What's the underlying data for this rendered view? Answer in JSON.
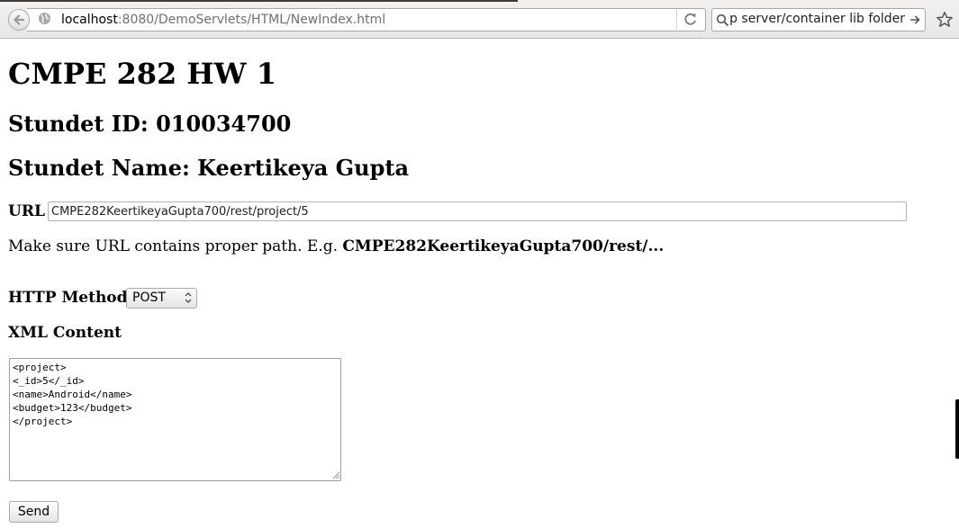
{
  "browser": {
    "url_host": "localhost",
    "url_rest": ":8080/DemoServlets/HTML/NewIndex.html",
    "search_text": "p server/container lib folder."
  },
  "page": {
    "title": "CMPE 282 HW 1",
    "student_id": "Stundet ID: 010034700",
    "student_name": "Stundet Name: Keertikeya Gupta",
    "url_label": "URL",
    "url_value": "CMPE282KeertikeyaGupta700/rest/project/5",
    "hint_text": "Make sure URL contains proper path. E.g. ",
    "hint_example": "CMPE282KeertikeyaGupta700/rest/...",
    "method_label": "HTTP Method",
    "method_value": "POST",
    "xml_label": "XML Content",
    "xml_content": "<project>\n<_id>5</_id>\n<name>Android</name>\n<budget>123</budget>\n</project>",
    "send_label": "Send"
  }
}
